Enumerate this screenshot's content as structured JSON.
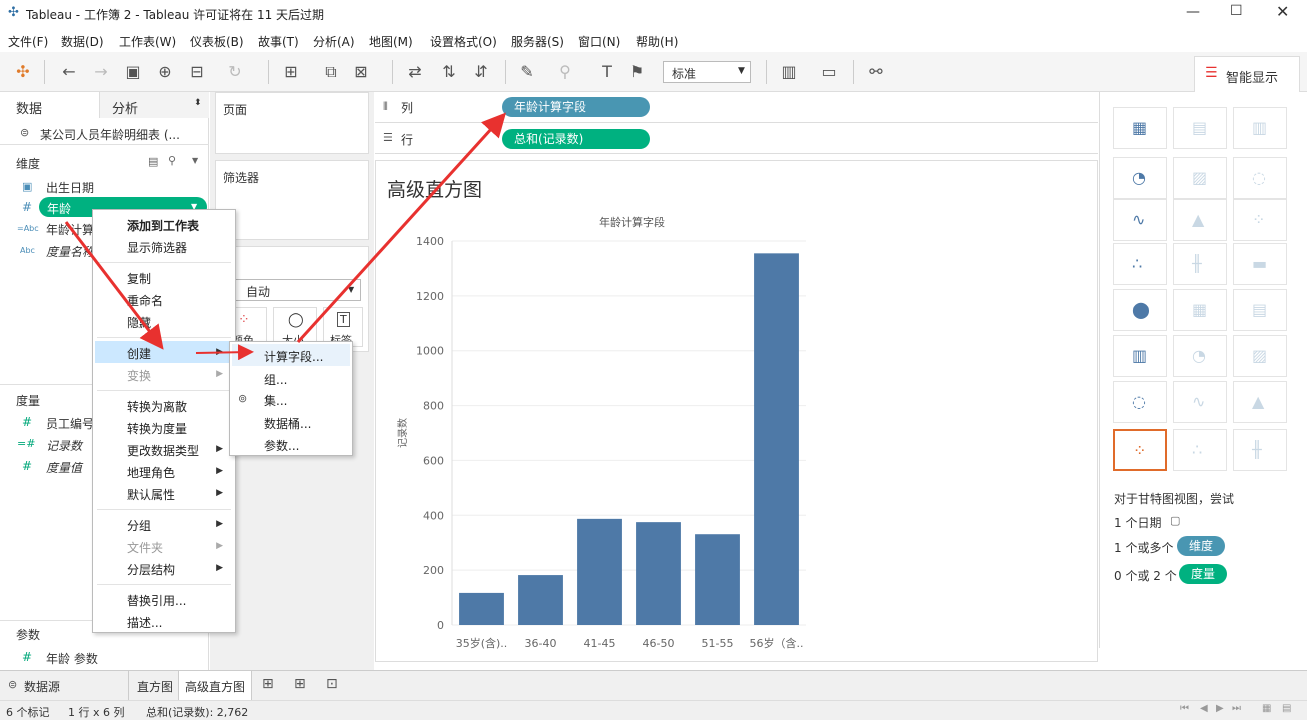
{
  "window": {
    "title": "Tableau - 工作簿 2 - Tableau 许可证将在 11 天后过期"
  },
  "menu": [
    "文件(F)",
    "数据(D)",
    "工作表(W)",
    "仪表板(B)",
    "故事(T)",
    "分析(A)",
    "地图(M)",
    "设置格式(O)",
    "服务器(S)",
    "窗口(N)",
    "帮助(H)"
  ],
  "toolbar": {
    "fit_select": "标准",
    "showme_label": "智能显示"
  },
  "left": {
    "tab_data": "数据",
    "tab_analysis": "分析",
    "datasource": "某公司人员年龄明细表 (...",
    "dimensions_header": "维度",
    "dimensions": [
      {
        "icon": "date-icon",
        "label": "出生日期"
      },
      {
        "icon": "number-icon",
        "label": "年龄"
      },
      {
        "icon": "calc-string-icon",
        "label": "年龄计算"
      },
      {
        "icon": "string-icon",
        "label": "度量名称"
      }
    ],
    "measures_header": "度量",
    "measures": [
      {
        "icon": "number-icon",
        "label": "员工编号"
      },
      {
        "icon": "calc-number-icon",
        "label": "记录数"
      },
      {
        "icon": "number-icon",
        "label": "度量值"
      }
    ],
    "params_header": "参数",
    "params": [
      {
        "icon": "number-icon",
        "label": "年龄 参数"
      }
    ]
  },
  "cards": {
    "pages": "页面",
    "filters": "筛选器",
    "marks": "记",
    "marks_type": "自动",
    "mark_buttons": [
      "颜色",
      "大小",
      "标签"
    ]
  },
  "shelves": {
    "columns_label": "列",
    "columns_pill": "年龄计算字段",
    "rows_label": "行",
    "rows_pill": "总和(记录数)"
  },
  "sheet": {
    "title": "高级直方图"
  },
  "chart_data": {
    "type": "bar",
    "title": "年龄计算字段",
    "xlabel": "",
    "ylabel": "记录数",
    "categories": [
      "35岁(含)..",
      "36-40",
      "41-45",
      "46-50",
      "51-55",
      "56岁（含.."
    ],
    "values": [
      117,
      182,
      387,
      375,
      331,
      1355
    ],
    "yticks": [
      "1400",
      "1200",
      "1000",
      "800",
      "600",
      "400",
      "200",
      "0"
    ],
    "ylim": [
      0,
      1400
    ],
    "color": "#4e79a7",
    "grid": true
  },
  "context_menu": {
    "items": [
      {
        "label": "添加到工作表",
        "bold": true
      },
      {
        "label": "显示筛选器"
      },
      {
        "label": "复制"
      },
      {
        "label": "重命名"
      },
      {
        "label": "隐藏"
      },
      {
        "label": "创建",
        "highlight": true
      },
      {
        "label": "变换",
        "disabled": true
      },
      {
        "label": "转换为离散"
      },
      {
        "label": "转换为度量"
      },
      {
        "label": "更改数据类型"
      },
      {
        "label": "地理角色"
      },
      {
        "label": "默认属性"
      },
      {
        "label": "分组"
      },
      {
        "label": "文件夹",
        "disabled": true
      },
      {
        "label": "分层结构"
      },
      {
        "label": "替换引用..."
      },
      {
        "label": "描述..."
      }
    ]
  },
  "submenu": {
    "items": [
      "计算字段...",
      "组...",
      "集...",
      "数据桶...",
      "参数..."
    ]
  },
  "showme": {
    "hint": "对于甘特图视图，尝试",
    "req1": "1 个日期",
    "req2": "1 个或多个",
    "req2_pill": "维度",
    "req3": "0 个或 2 个",
    "req3_pill": "度量"
  },
  "tabs": {
    "datasource": "数据源",
    "sheet1": "直方图",
    "sheet2": "高级直方图"
  },
  "status": {
    "marks": "6 个标记",
    "grid": "1 行 x 6 列",
    "sum": "总和(记录数): 2,762"
  },
  "colors": {
    "dim_pill": "#4996b2",
    "meas_pill": "#00b180",
    "bar": "#4e79a7",
    "highlight": "#cce8ff",
    "arrow": "#e8312f"
  }
}
